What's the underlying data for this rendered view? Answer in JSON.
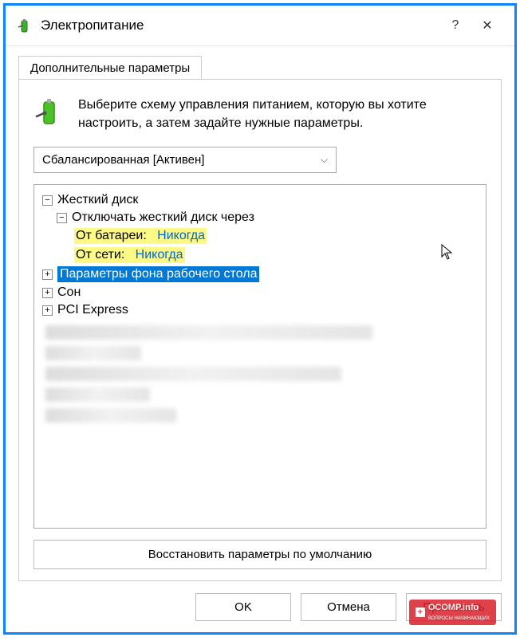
{
  "window": {
    "title": "Электропитание",
    "help_symbol": "?",
    "close_symbol": "✕"
  },
  "tab": {
    "label": "Дополнительные параметры"
  },
  "intro": {
    "text": "Выберите схему управления питанием, которую вы хотите настроить, а затем задайте нужные параметры."
  },
  "scheme": {
    "selected": "Сбалансированная [Активен]"
  },
  "tree": {
    "hard_disk": {
      "label": "Жесткий диск",
      "expanded": true
    },
    "turn_off": {
      "label": "Отключать жесткий диск через",
      "expanded": true
    },
    "on_battery": {
      "label": "От батареи:",
      "value": "Никогда"
    },
    "plugged_in": {
      "label": "От сети:",
      "value": "Никогда"
    },
    "desktop_bg": {
      "label": "Параметры фона рабочего стола",
      "expanded": false
    },
    "sleep": {
      "label": "Сон",
      "expanded": false
    },
    "pci": {
      "label": "PCI Express",
      "expanded": false
    }
  },
  "buttons": {
    "restore_defaults": "Восстановить параметры по умолчанию",
    "ok": "OK",
    "cancel": "Отмена",
    "apply": "Применить"
  },
  "watermark": {
    "text": "OCOMP.info",
    "subtitle": "ВОПРОСЫ НАЧИНАЮЩИХ"
  }
}
